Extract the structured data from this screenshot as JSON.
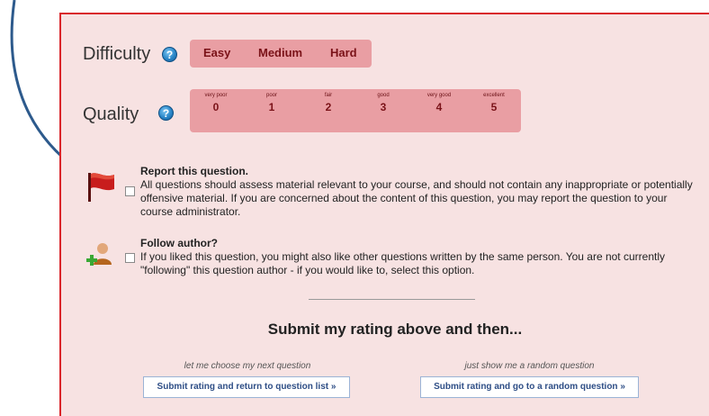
{
  "difficulty": {
    "label": "Difficulty",
    "help_icon": "?",
    "options": [
      "Easy",
      "Medium",
      "Hard"
    ]
  },
  "quality": {
    "label": "Quality",
    "help_icon": "?",
    "options": [
      {
        "desc": "very poor",
        "value": "0"
      },
      {
        "desc": "poor",
        "value": "1"
      },
      {
        "desc": "fair",
        "value": "2"
      },
      {
        "desc": "good",
        "value": "3"
      },
      {
        "desc": "very good",
        "value": "4"
      },
      {
        "desc": "excellent",
        "value": "5"
      }
    ]
  },
  "report": {
    "title": "Report this question.",
    "text": "All questions should assess material relevant to your course, and should not contain any inappropriate or potentially offensive material. If you are concerned about the content of this question, you may report the question to your course administrator.",
    "icon": "flag-icon"
  },
  "follow": {
    "title": "Follow author?",
    "text": "If you liked this question, you might also like other questions written by the same person. You are not currently \"following\" this question author - if you would like to, select this option.",
    "icon": "add-user-icon"
  },
  "submit": {
    "heading": "Submit my rating above and then...",
    "left_caption": "let me choose my next question",
    "left_button": "Submit rating and return to question list »",
    "right_caption": "just show me a random question",
    "right_button": "Submit rating and go to a random question »"
  },
  "colors": {
    "panel_border": "#d9262b",
    "panel_bg": "#f7e2e2",
    "pill_bg": "#e99ea3",
    "arrow": "#2d5a8c"
  }
}
